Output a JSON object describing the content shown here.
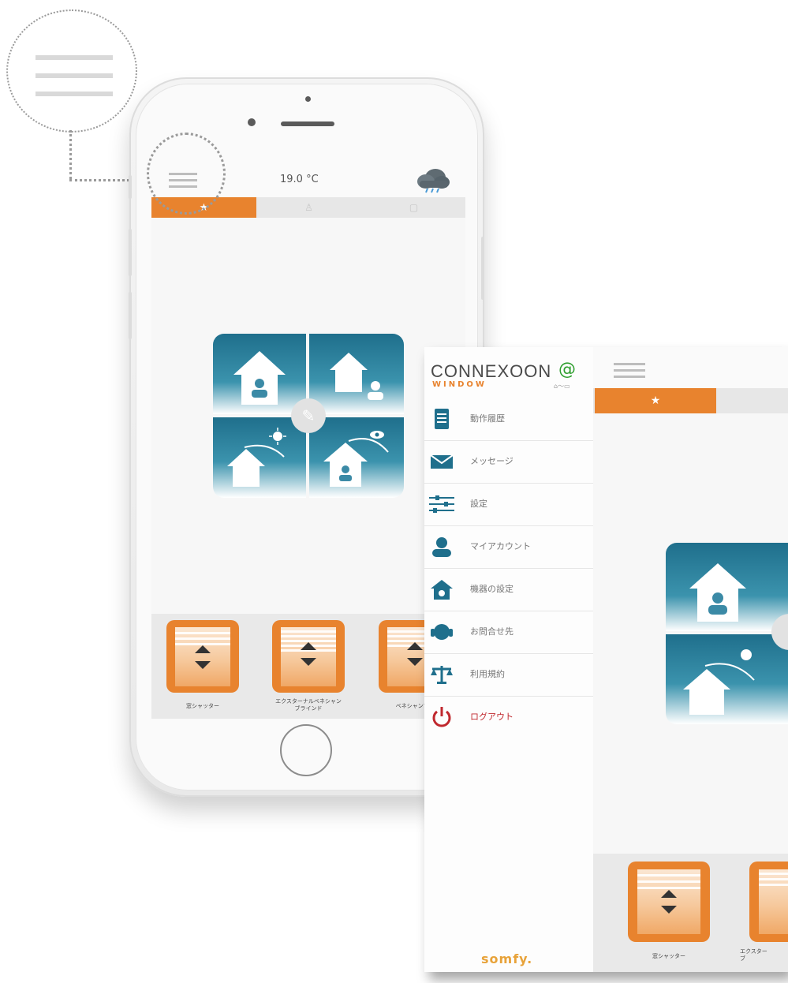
{
  "main_screen": {
    "temperature": "19.0 °C",
    "weather_icon": "cloud-rain-icon",
    "tabs": [
      {
        "icon": "star-icon",
        "active": true
      },
      {
        "icon": "person-icon",
        "active": false
      },
      {
        "icon": "device-icon",
        "active": false
      }
    ],
    "devices": [
      {
        "label": "窓シャッター"
      },
      {
        "label": "エクスターナルベネシャン\nブラインド"
      },
      {
        "label": "ベネシャンブラ"
      }
    ]
  },
  "menu": {
    "logo": "CONNEXOON",
    "logo_sub": "WINDOW",
    "status_icon": "internet-connection-icon",
    "items": [
      {
        "label": "動作履歴",
        "icon": "history-icon"
      },
      {
        "label": "メッセージ",
        "icon": "envelope-icon"
      },
      {
        "label": "設定",
        "icon": "sliders-icon"
      },
      {
        "label": "マイアカウント",
        "icon": "user-icon"
      },
      {
        "label": "機器の設定",
        "icon": "house-gear-icon"
      },
      {
        "label": "お問合せ先",
        "icon": "headset-icon"
      },
      {
        "label": "利用規約",
        "icon": "scales-icon"
      },
      {
        "label": "ログアウト",
        "icon": "power-icon"
      }
    ],
    "brand": "somfy."
  },
  "second_screen": {
    "devices": [
      {
        "label": "窓シャッター"
      },
      {
        "label": "エクスター\nブ"
      }
    ]
  },
  "colors": {
    "accent": "#e8832e",
    "tile_blue": "#1f7a99",
    "logout_red": "#c0282e"
  }
}
